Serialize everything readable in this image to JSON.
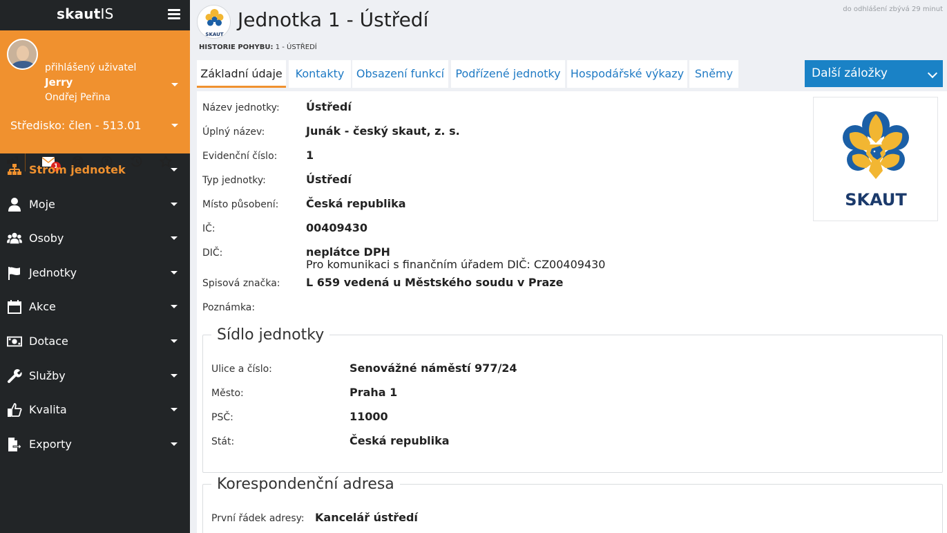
{
  "app": {
    "brand_bold": "skaut",
    "brand_rest": "IS",
    "session_timeout": "do odhlášení zbývá 29 minut"
  },
  "user": {
    "logged_label": "přihlášený uživatel",
    "nickname": "Jerry",
    "full_name": "Ondřej Peřina",
    "role": "Středisko: člen - 513.01",
    "mail_badge": "1"
  },
  "toolbar": {
    "icons": [
      "logout-icon",
      "mail-icon",
      "help-ring-icon",
      "question-icon",
      "history-icon",
      "star-icon"
    ]
  },
  "menu": {
    "items": [
      {
        "label": "Strom jednotek",
        "icon": "sitemap-icon",
        "active": true
      },
      {
        "label": "Moje",
        "icon": "user-icon"
      },
      {
        "label": "Osoby",
        "icon": "users-icon"
      },
      {
        "label": "Jednotky",
        "icon": "flag-icon"
      },
      {
        "label": "Akce",
        "icon": "calendar-icon"
      },
      {
        "label": "Dotace",
        "icon": "money-icon"
      },
      {
        "label": "Služby",
        "icon": "wrench-icon"
      },
      {
        "label": "Kvalita",
        "icon": "thumbs-up-icon"
      },
      {
        "label": "Exporty",
        "icon": "export-icon"
      }
    ]
  },
  "header": {
    "title": "Jednotka 1 - Ústředí",
    "breadcrumb_label": "HISTORIE POHYBU:",
    "breadcrumb_value": "1 - ÚSTŘEDÍ"
  },
  "tabs": {
    "items": [
      "Základní údaje",
      "Kontakty",
      "Obsazení funkcí",
      "Podřízené jednotky",
      "Hospodářské výkazy",
      "Sněmy"
    ],
    "more_label": "Další záložky"
  },
  "details": {
    "rows": [
      {
        "label": "Název jednotky:",
        "value": "Ústředí"
      },
      {
        "label": "Úplný název:",
        "value": "Junák - český skaut, z. s."
      },
      {
        "label": "Evidenční číslo:",
        "value": "1"
      },
      {
        "label": "Typ jednotky:",
        "value": "Ústředí"
      },
      {
        "label": "Místo působení:",
        "value": "Česká republika"
      },
      {
        "label": "IČ:",
        "value": "00409430"
      },
      {
        "label": "DIČ:",
        "value": "neplátce DPH",
        "extra": "Pro komunikaci s finančním úřadem DIČ: CZ00409430"
      },
      {
        "label": "Spisová značka:",
        "value": "L 659 vedená u Městského soudu v Praze"
      },
      {
        "label": "Poznámka:",
        "value": ""
      }
    ],
    "logo_text": "SKAUT",
    "small_logo_text": "SKAUT"
  },
  "seat": {
    "legend": "Sídlo jednotky",
    "rows": [
      {
        "label": "Ulice a číslo:",
        "value": "Senovážné náměstí 977/24"
      },
      {
        "label": "Město:",
        "value": "Praha 1"
      },
      {
        "label": "PSČ:",
        "value": "11000"
      },
      {
        "label": "Stát:",
        "value": "Česká republika"
      }
    ]
  },
  "correspondence": {
    "legend": "Korespondenční adresa",
    "rows": [
      {
        "label": "První řádek adresy:",
        "value": "Kancelář ústředí"
      }
    ]
  },
  "colors": {
    "accent": "#f0912f",
    "sidebar": "#222527",
    "link": "#1f7ac4",
    "more_button": "#1a82c6"
  }
}
